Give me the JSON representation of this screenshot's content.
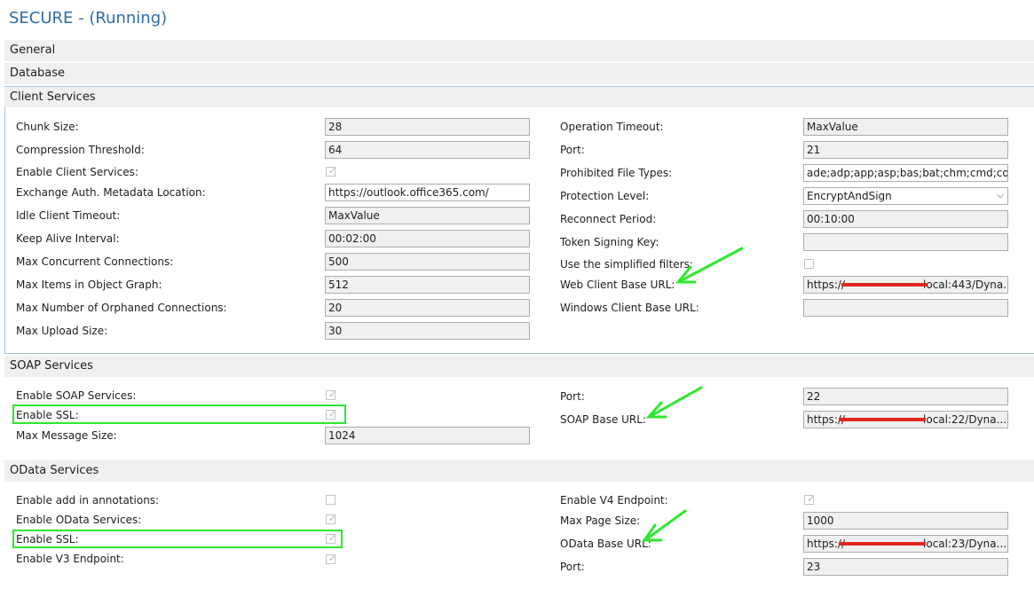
{
  "title": "SECURE - (Running)",
  "sections": {
    "general": "General",
    "database": "Database",
    "client": "Client Services",
    "soap": "SOAP Services",
    "odata": "OData Services"
  },
  "client": {
    "left": [
      {
        "label": "Chunk Size:",
        "value": "28"
      },
      {
        "label": "Compression Threshold:",
        "value": "64"
      },
      {
        "label": "Enable Client Services:",
        "checked": true
      },
      {
        "label": "Exchange Auth. Metadata Location:",
        "value": "https://outlook.office365.com/"
      },
      {
        "label": "Idle Client Timeout:",
        "value": "MaxValue"
      },
      {
        "label": "Keep Alive Interval:",
        "value": "00:02:00"
      },
      {
        "label": "Max Concurrent Connections:",
        "value": "500"
      },
      {
        "label": "Max Items in Object Graph:",
        "value": "512"
      },
      {
        "label": "Max Number of Orphaned Connections:",
        "value": "20"
      },
      {
        "label": "Max Upload Size:",
        "value": "30"
      }
    ],
    "right": [
      {
        "label": "Operation Timeout:",
        "value": "MaxValue"
      },
      {
        "label": "Port:",
        "value": "21"
      },
      {
        "label": "Prohibited File Types:",
        "value": "ade;adp;app;asp;bas;bat;chm;cmd;com;cp"
      },
      {
        "label": "Protection Level:",
        "value": "EncryptAndSign"
      },
      {
        "label": "Reconnect Period:",
        "value": "00:10:00"
      },
      {
        "label": "Token Signing Key:",
        "value": ""
      },
      {
        "label": "Use the simplified filters:",
        "checked": false
      },
      {
        "label": "Web Client Base URL:",
        "value_prefix": "https://",
        "value_suffix": "local:443/Dyna..."
      },
      {
        "label": "Windows Client Base URL:",
        "value": ""
      }
    ]
  },
  "soap": {
    "left": [
      {
        "label": "Enable SOAP Services:",
        "checked": true
      },
      {
        "label": "Enable SSL:",
        "checked": true
      },
      {
        "label": "Max Message Size:",
        "value": "1024"
      }
    ],
    "right": [
      {
        "label": "Port:",
        "value": "22"
      },
      {
        "label": "SOAP Base URL:",
        "value_prefix": "https://",
        "value_suffix": "local:22/Dyna..."
      }
    ]
  },
  "odata": {
    "left": [
      {
        "label": "Enable add in annotations:",
        "checked": false
      },
      {
        "label": "Enable OData Services:",
        "checked": true
      },
      {
        "label": "Enable SSL:",
        "checked": true
      },
      {
        "label": "Enable V3 Endpoint:",
        "checked": true
      }
    ],
    "right": [
      {
        "label": "Enable V4 Endpoint:",
        "checked": true
      },
      {
        "label": "Max Page Size:",
        "value": "1000"
      },
      {
        "label": "OData Base URL:",
        "value_prefix": "https://",
        "value_suffix": "local:23/Dyna..."
      },
      {
        "label": "Port:",
        "value": "23"
      }
    ]
  },
  "colors": {
    "title": "#2e6da4",
    "highlight_green": "#2ee82e",
    "redaction_red": "#e0261e",
    "section_bg": "#f0f0f0"
  },
  "icons": {
    "checkbox": "check-mark-icon",
    "dropdown": "chevron-down-icon",
    "arrow": "annotation-arrow-icon"
  }
}
